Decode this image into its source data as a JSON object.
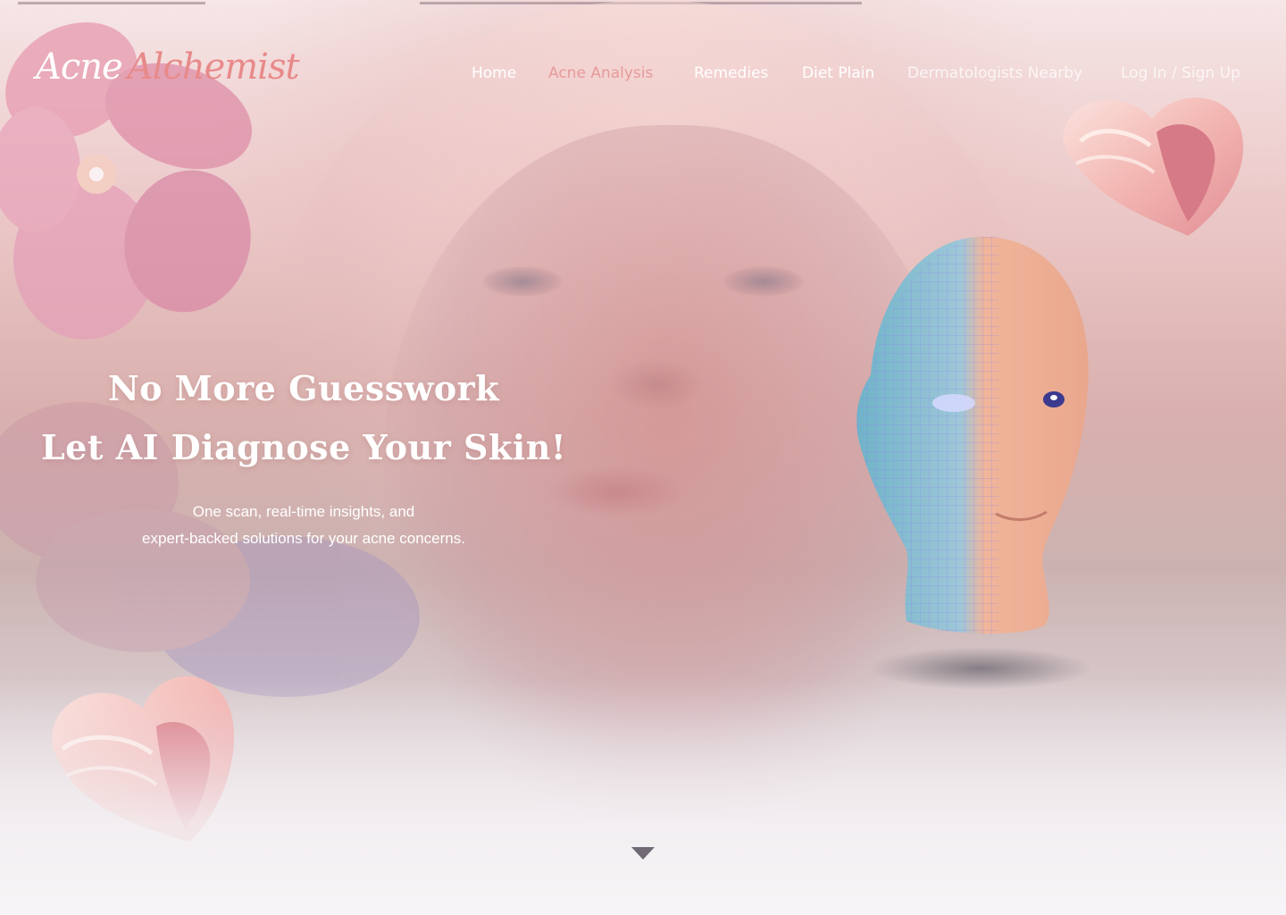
{
  "brand": {
    "word1": "Acne",
    "word2": "Alchemist"
  },
  "nav": {
    "home": "Home",
    "acne_analysis": "Acne Analysis",
    "remedies": "Remedies",
    "diet_plan": "Diet Plain",
    "dermatologists": "Dermatologists Nearby",
    "auth": "Log In / Sign Up",
    "active_item": "Acne Analysis"
  },
  "hero": {
    "headline_1": "No More Guesswork",
    "headline_2": "Let AI Diagnose Your Skin!",
    "subtext_1": "One scan, real-time insights, and",
    "subtext_2": "expert-backed solutions for your acne concerns."
  },
  "colors": {
    "accent": "#e88a8a",
    "text_light": "#ffffff",
    "arrow": "#6f6a74"
  },
  "icons": [
    "scroll-down-arrow-icon",
    "heart-sculpture-icon",
    "flower-icon",
    "3d-head-icon"
  ]
}
